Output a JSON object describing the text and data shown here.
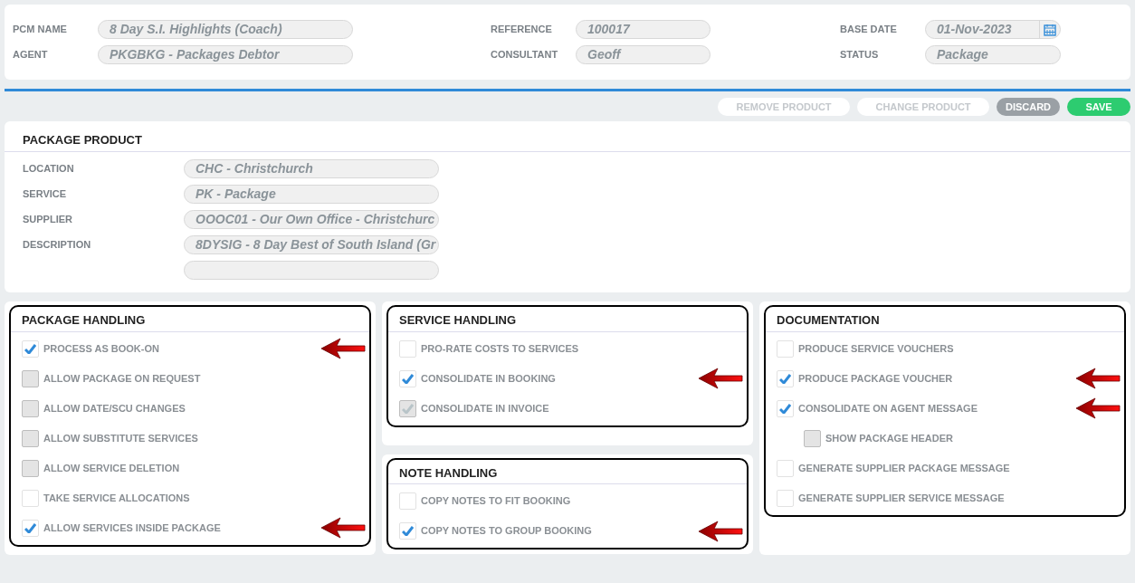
{
  "header": {
    "columns": [
      [
        {
          "label": "PCM NAME",
          "value": "8 Day S.I. Highlights (Coach)"
        },
        {
          "label": "AGENT",
          "value": "PKGBKG - Packages Debtor"
        }
      ],
      [
        {
          "label": "REFERENCE",
          "value": "100017"
        },
        {
          "label": "CONSULTANT",
          "value": "Geoff"
        }
      ],
      [
        {
          "label": "BASE DATE",
          "value": "01-Nov-2023",
          "kind": "date"
        },
        {
          "label": "STATUS",
          "value": "Package",
          "kind": "text"
        }
      ]
    ]
  },
  "toolbar": [
    {
      "label": "REMOVE PRODUCT",
      "kind": "disabled"
    },
    {
      "label": "CHANGE PRODUCT",
      "kind": "disabled"
    },
    {
      "label": "DISCARD",
      "kind": "neutral"
    },
    {
      "label": "SAVE",
      "kind": "primary"
    }
  ],
  "package_product": {
    "title": "PACKAGE PRODUCT",
    "fields": [
      {
        "kind": "text",
        "label": "LOCATION",
        "value": "CHC - Christchurch"
      },
      {
        "kind": "text",
        "label": "SERVICE",
        "value": "PK - Package"
      },
      {
        "kind": "text",
        "label": "SUPPLIER",
        "value": "OOOC01 - Our Own Office - Christchurc"
      },
      {
        "kind": "text",
        "label": "DESCRIPTION",
        "value": "8DYSIG - 8 Day Best of South Island (Gr"
      },
      {
        "kind": "blank"
      }
    ]
  },
  "section_columns": [
    [
      {
        "title": "PACKAGE HANDLING",
        "items": [
          {
            "label": "PROCESS AS BOOK-ON",
            "checked": true,
            "disabled": false,
            "arrow": true
          },
          {
            "label": "ALLOW PACKAGE ON REQUEST",
            "checked": false,
            "disabled": true,
            "arrow": false
          },
          {
            "label": "ALLOW DATE/SCU CHANGES",
            "checked": false,
            "disabled": true,
            "arrow": false
          },
          {
            "label": "ALLOW SUBSTITUTE SERVICES",
            "checked": false,
            "disabled": true,
            "arrow": false
          },
          {
            "label": "ALLOW SERVICE DELETION",
            "checked": false,
            "disabled": true,
            "arrow": false
          },
          {
            "label": "TAKE SERVICE ALLOCATIONS",
            "checked": false,
            "disabled": false,
            "arrow": false
          },
          {
            "label": "ALLOW SERVICES INSIDE PACKAGE",
            "checked": true,
            "disabled": false,
            "arrow": true
          }
        ]
      }
    ],
    [
      {
        "title": "SERVICE HANDLING",
        "items": [
          {
            "label": "PRO-RATE COSTS TO SERVICES",
            "checked": false,
            "disabled": false,
            "arrow": false
          },
          {
            "label": "CONSOLIDATE IN BOOKING",
            "checked": true,
            "disabled": false,
            "arrow": true
          },
          {
            "label": "CONSOLIDATE IN INVOICE",
            "checked": true,
            "disabled": true,
            "arrow": false
          }
        ]
      },
      {
        "title": "NOTE HANDLING",
        "items": [
          {
            "label": "COPY NOTES TO FIT BOOKING",
            "checked": false,
            "disabled": false,
            "arrow": false
          },
          {
            "label": "COPY NOTES TO GROUP BOOKING",
            "checked": true,
            "disabled": false,
            "arrow": true
          }
        ]
      }
    ],
    [
      {
        "title": "DOCUMENTATION",
        "items": [
          {
            "label": "PRODUCE SERVICE VOUCHERS",
            "checked": false,
            "disabled": false,
            "arrow": false
          },
          {
            "label": "PRODUCE PACKAGE VOUCHER",
            "checked": true,
            "disabled": false,
            "arrow": true
          },
          {
            "label": "CONSOLIDATE ON AGENT MESSAGE",
            "checked": true,
            "disabled": false,
            "arrow": true,
            "children": [
              {
                "label": "SHOW PACKAGE HEADER",
                "checked": false,
                "disabled": true,
                "arrow": false
              }
            ]
          },
          {
            "label": "GENERATE SUPPLIER PACKAGE MESSAGE",
            "checked": false,
            "disabled": false,
            "arrow": false
          },
          {
            "label": "GENERATE SUPPLIER SERVICE MESSAGE",
            "checked": false,
            "disabled": false,
            "arrow": false
          }
        ]
      }
    ]
  ]
}
